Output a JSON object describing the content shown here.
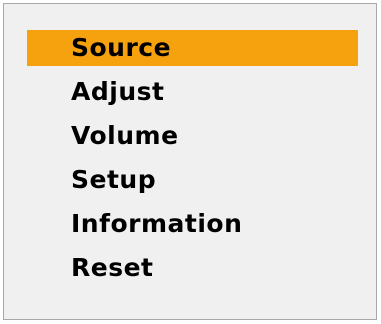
{
  "menu": {
    "selected_index": 0,
    "highlight_color": "#f6a20f",
    "background_color": "#f0f0f0",
    "items": [
      {
        "label": "Source"
      },
      {
        "label": "Adjust"
      },
      {
        "label": "Volume"
      },
      {
        "label": "Setup"
      },
      {
        "label": "Information"
      },
      {
        "label": "Reset"
      }
    ]
  }
}
